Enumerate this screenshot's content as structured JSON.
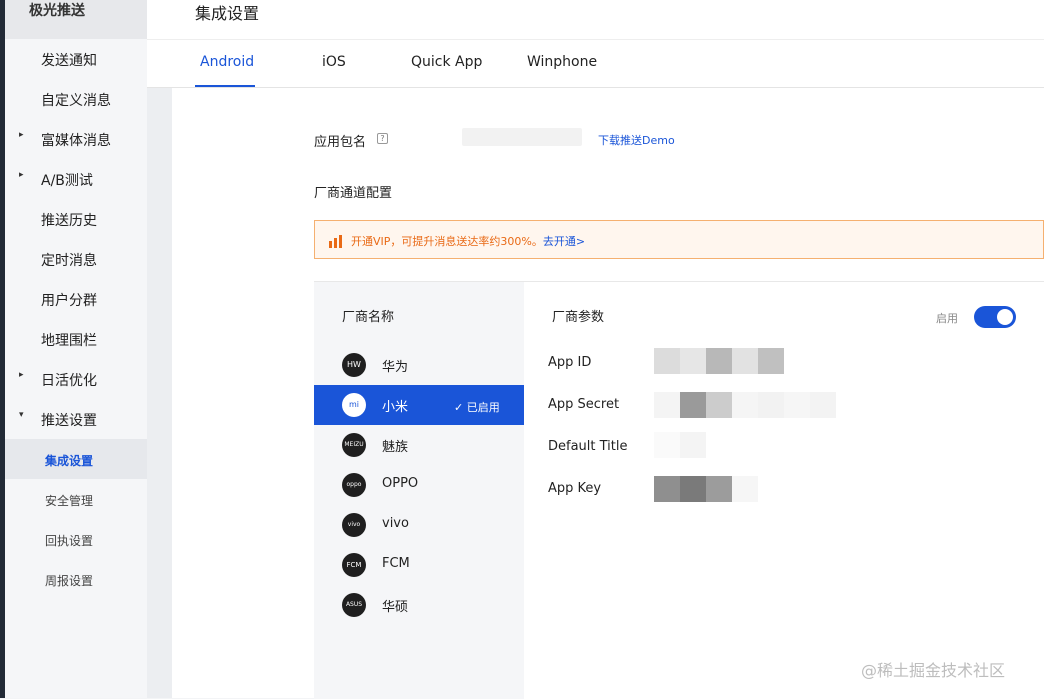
{
  "sidebar": {
    "app_name": "极光推送",
    "items": [
      {
        "label": "发送通知",
        "arrow": ""
      },
      {
        "label": "自定义消息",
        "arrow": ""
      },
      {
        "label": "富媒体消息",
        "arrow": "▸"
      },
      {
        "label": "A/B测试",
        "arrow": "▸"
      },
      {
        "label": "推送历史",
        "arrow": ""
      },
      {
        "label": "定时消息",
        "arrow": ""
      },
      {
        "label": "用户分群",
        "arrow": ""
      },
      {
        "label": "地理围栏",
        "arrow": ""
      },
      {
        "label": "日活优化",
        "arrow": "▸"
      },
      {
        "label": "推送设置",
        "arrow": "▾"
      }
    ],
    "sub_items": [
      {
        "label": "集成设置",
        "active": true
      },
      {
        "label": "安全管理",
        "active": false
      },
      {
        "label": "回执设置",
        "active": false
      },
      {
        "label": "周报设置",
        "active": false
      }
    ]
  },
  "header": {
    "title": "集成设置"
  },
  "tabs": [
    {
      "label": "Android",
      "active": true
    },
    {
      "label": "iOS",
      "active": false
    },
    {
      "label": "Quick App",
      "active": false
    },
    {
      "label": "Winphone",
      "active": false
    }
  ],
  "form": {
    "package_label": "应用包名",
    "help_icon": "?",
    "download_link": "下载推送Demo",
    "vendor_config_label": "厂商通道配置"
  },
  "notice": {
    "text": "开通VIP，可提升消息送达率约300%。",
    "link": "去开通>"
  },
  "vendors": {
    "header": "厂商名称",
    "enabled_badge": "✓ 已启用",
    "items": [
      {
        "name": "华为",
        "logo": "HW",
        "active": false
      },
      {
        "name": "小米",
        "logo": "mi",
        "active": true
      },
      {
        "name": "魅族",
        "logo": "MEIZU",
        "active": false
      },
      {
        "name": "OPPO",
        "logo": "oppo",
        "active": false
      },
      {
        "name": "vivo",
        "logo": "vivo",
        "active": false
      },
      {
        "name": "FCM",
        "logo": "FCM",
        "active": false
      },
      {
        "name": "华硕",
        "logo": "ASUS",
        "active": false
      }
    ]
  },
  "params": {
    "header": "厂商参数",
    "toggle_label": "启用",
    "toggle_on": true,
    "fields": [
      {
        "label": "App ID"
      },
      {
        "label": "App Secret"
      },
      {
        "label": "Default Title"
      },
      {
        "label": "App Key"
      }
    ]
  },
  "watermark": "@稀土掘金技术社区",
  "colors": {
    "accent": "#1a55d8",
    "warning": "#e96a16"
  }
}
